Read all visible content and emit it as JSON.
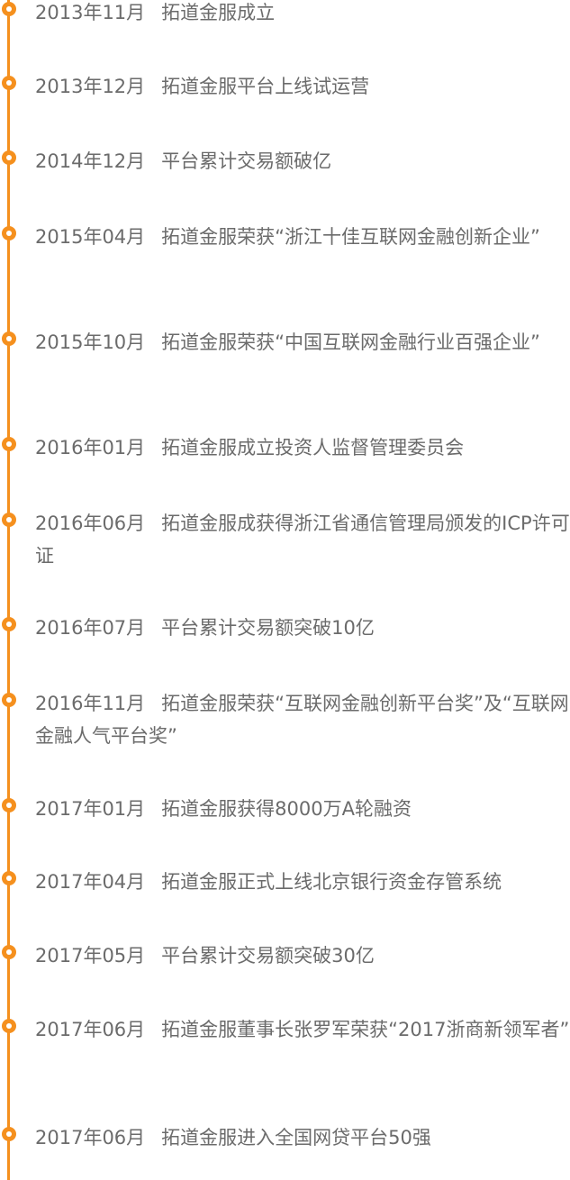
{
  "timeline": {
    "accent_color": "#f5901e",
    "text_color": "#6b6b6b",
    "events": [
      {
        "date": "2013年11月",
        "text": "拓道金服成立"
      },
      {
        "date": "2013年12月",
        "text": "拓道金服平台上线试运营"
      },
      {
        "date": "2014年12月",
        "text": "平台累计交易额破亿"
      },
      {
        "date": "2015年04月",
        "text": "拓道金服荣获“浙江十佳互联网金融创新企业”"
      },
      {
        "date": "2015年10月",
        "text": "拓道金服荣获“中国互联网金融行业百强企业”"
      },
      {
        "date": "2016年01月",
        "text": "拓道金服成立投资人监督管理委员会"
      },
      {
        "date": "2016年06月",
        "text": "拓道金服成获得浙江省通信管理局颁发的ICP许可证"
      },
      {
        "date": "2016年07月",
        "text": "平台累计交易额突破10亿"
      },
      {
        "date": "2016年11月",
        "text": "拓道金服荣获“互联网金融创新平台奖”及“互联网金融人气平台奖”"
      },
      {
        "date": "2017年01月",
        "text": "拓道金服获得8000万A轮融资"
      },
      {
        "date": "2017年04月",
        "text": "拓道金服正式上线北京银行资金存管系统"
      },
      {
        "date": "2017年05月",
        "text": "平台累计交易额突破30亿"
      },
      {
        "date": "2017年06月",
        "text": "拓道金服董事长张罗军荣获“2017浙商新领军者”"
      },
      {
        "date": "2017年06月",
        "text": "拓道金服进入全国网贷平台50强"
      }
    ]
  }
}
